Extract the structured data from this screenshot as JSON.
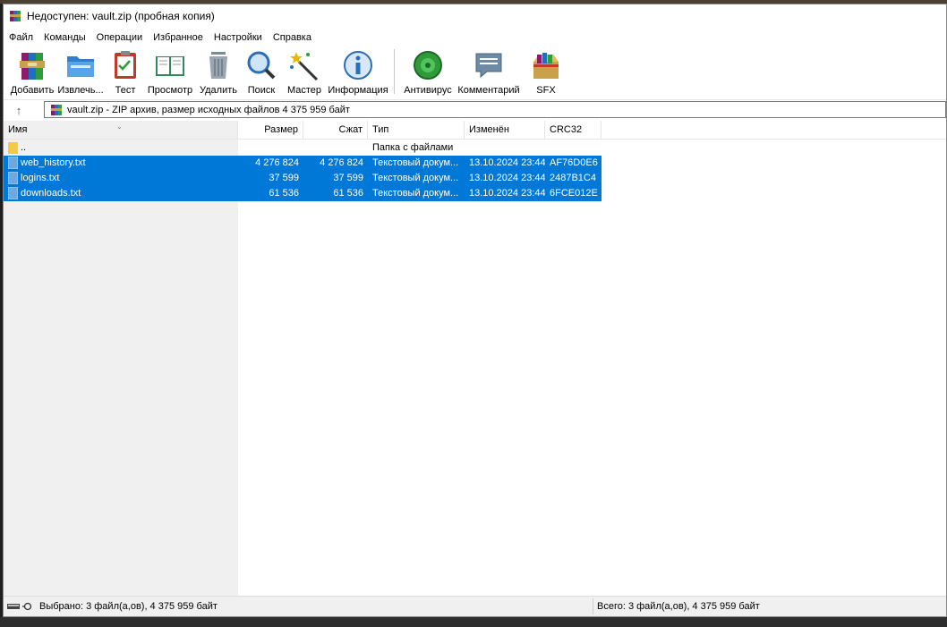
{
  "window": {
    "title": "Недоступен: vault.zip (пробная копия)"
  },
  "menu": [
    "Файл",
    "Команды",
    "Операции",
    "Избранное",
    "Настройки",
    "Справка"
  ],
  "toolbar": {
    "add": "Добавить",
    "extract": "Извлечь...",
    "test": "Тест",
    "view": "Просмотр",
    "delete": "Удалить",
    "find": "Поиск",
    "wizard": "Мастер",
    "info": "Информация",
    "antivirus": "Антивирус",
    "comment": "Комментарий",
    "sfx": "SFX"
  },
  "address": {
    "text": "vault.zip - ZIP архив, размер исходных файлов 4 375 959 байт"
  },
  "columns": {
    "name": "Имя",
    "size": "Размер",
    "packed": "Сжат",
    "type": "Тип",
    "modified": "Изменён",
    "crc": "CRC32"
  },
  "files": [
    {
      "name": "..",
      "size": "",
      "packed": "",
      "type": "Папка с файлами",
      "modified": "",
      "crc": ""
    },
    {
      "name": "web_history.txt",
      "size": "4 276 824",
      "packed": "4 276 824",
      "type": "Текстовый докум...",
      "modified": "13.10.2024 23:44",
      "crc": "AF76D0E6"
    },
    {
      "name": "logins.txt",
      "size": "37 599",
      "packed": "37 599",
      "type": "Текстовый докум...",
      "modified": "13.10.2024 23:44",
      "crc": "2487B1C4"
    },
    {
      "name": "downloads.txt",
      "size": "61 536",
      "packed": "61 536",
      "type": "Текстовый докум...",
      "modified": "13.10.2024 23:44",
      "crc": "6FCE012E"
    }
  ],
  "status": {
    "selected": "Выбрано: 3 файл(а,ов), 4 375 959 байт",
    "total": "Всего: 3 файл(а,ов), 4 375 959 байт"
  },
  "colors": {
    "selection": "#0078d7",
    "window_bg": "#ffffff",
    "left_panel_bg": "#f0f0f0"
  }
}
